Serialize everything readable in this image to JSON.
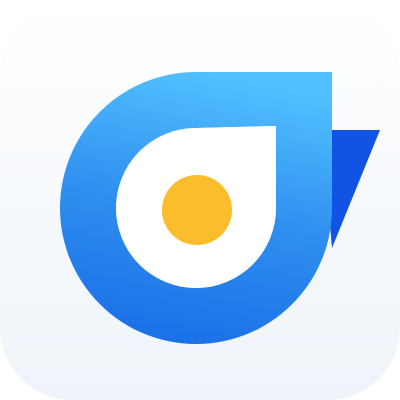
{
  "app_icon": {
    "icon_name": "app-logo-icon",
    "shape": "rounded-square",
    "colors": {
      "background_top": "#ffffff",
      "background_bottom": "#eef4fa",
      "ring_light": "#52c1ff",
      "ring_mid": "#2f8ff0",
      "ring_dark": "#1a6fe6",
      "tail_blue": "#1253e6",
      "inner_fill": "#ffffff",
      "center_dot": "#fbbd2c"
    }
  }
}
